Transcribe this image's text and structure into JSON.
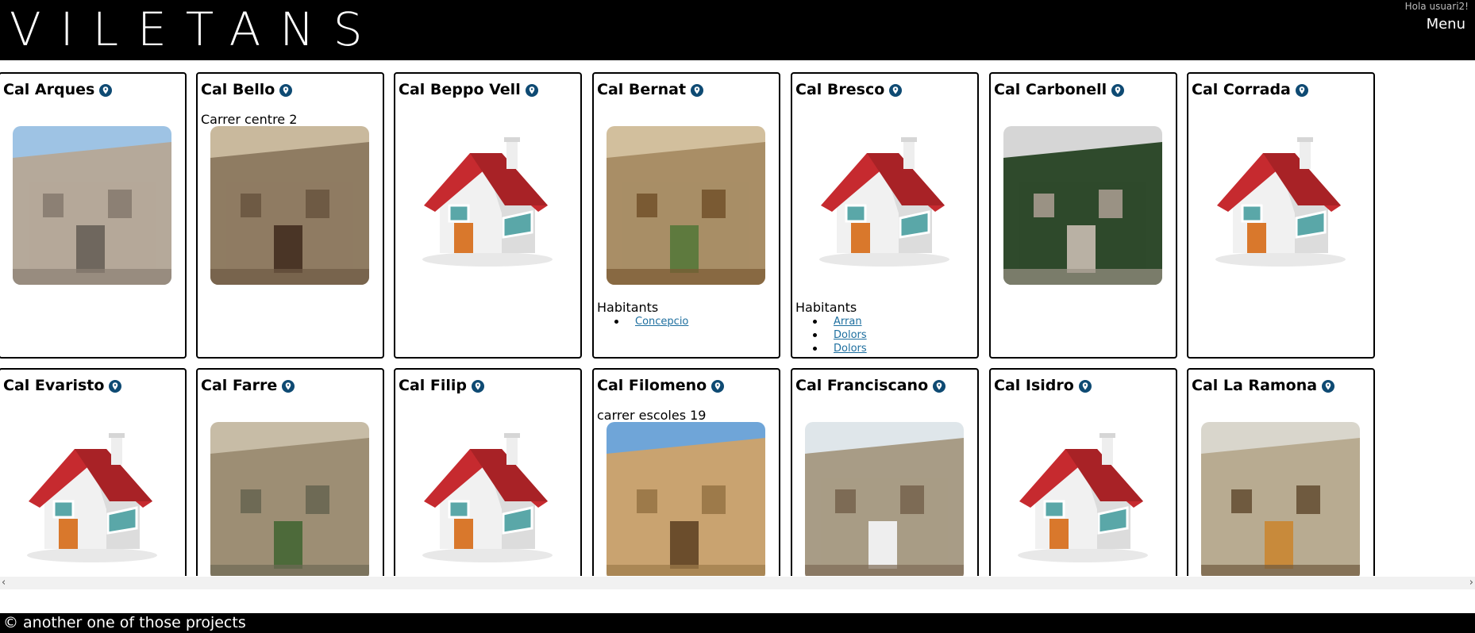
{
  "header": {
    "logo": "VILETANS",
    "greeting": "Hola usuari2!",
    "menu_label": "Menu"
  },
  "cards": [
    {
      "name": "Cal Arques",
      "address": "",
      "photo": "photo-stone-street",
      "habitants_label": "",
      "habitants": []
    },
    {
      "name": "Cal Bello",
      "address": "Carrer centre 2",
      "photo": "photo-stone-house-balcony",
      "habitants_label": "",
      "habitants": []
    },
    {
      "name": "Cal Beppo Vell",
      "address": "",
      "photo": "placeholder-house-icon",
      "habitants_label": "",
      "habitants": []
    },
    {
      "name": "Cal Bernat",
      "address": "",
      "photo": "photo-arched-door",
      "habitants_label": "Habitants",
      "habitants": [
        "Concepcio"
      ]
    },
    {
      "name": "Cal Bresco",
      "address": "",
      "photo": "placeholder-house-icon",
      "habitants_label": "Habitants",
      "habitants": [
        "Arran",
        "Dolors",
        "Dolors"
      ]
    },
    {
      "name": "Cal Carbonell",
      "address": "",
      "photo": "photo-cypress-wall",
      "habitants_label": "",
      "habitants": []
    },
    {
      "name": "Cal Corrada",
      "address": "",
      "photo": "placeholder-house-icon",
      "habitants_label": "",
      "habitants": []
    },
    {
      "name": "Cal Evaristo",
      "address": "",
      "photo": "placeholder-house-icon",
      "habitants_label": "",
      "habitants": []
    },
    {
      "name": "Cal Farre",
      "address": "",
      "photo": "photo-stone-facade-plants",
      "habitants_label": "",
      "habitants": []
    },
    {
      "name": "Cal Filip",
      "address": "",
      "photo": "placeholder-house-icon",
      "habitants_label": "",
      "habitants": []
    },
    {
      "name": "Cal Filomeno",
      "address": "carrer escoles 19",
      "photo": "photo-narrow-stone-street",
      "habitants_label": "",
      "habitants": []
    },
    {
      "name": "Cal Franciscano",
      "address": "",
      "photo": "photo-street-white-car",
      "habitants_label": "",
      "habitants": []
    },
    {
      "name": "Cal Isidro",
      "address": "",
      "photo": "placeholder-house-icon",
      "habitants_label": "",
      "habitants": []
    },
    {
      "name": "Cal La Ramona",
      "address": "",
      "photo": "photo-white-facade-balcony",
      "habitants_label": "",
      "habitants": []
    }
  ],
  "footer": {
    "text": "© another one of those projects"
  },
  "scroll": {
    "left_arrow": "‹",
    "right_arrow": "›"
  },
  "colors": {
    "header_bg": "#000000",
    "link": "#1e6f9f",
    "pin": "#0e4a73",
    "roof": "#c62a2f",
    "door": "#d9782c"
  }
}
